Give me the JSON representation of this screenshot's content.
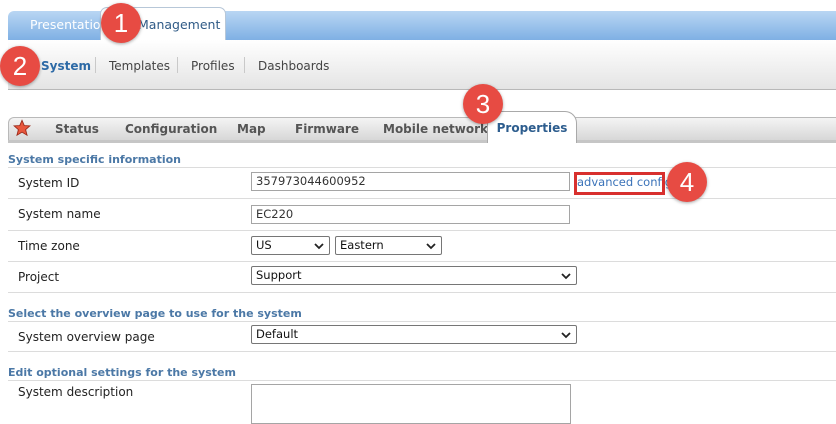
{
  "top_tabs": [
    "Presentation",
    "Management"
  ],
  "sub_nav": [
    "System",
    "Templates",
    "Profiles",
    "Dashboards"
  ],
  "tabs": [
    "Status",
    "Configuration",
    "Map",
    "Firmware",
    "Mobile network",
    "Properties"
  ],
  "sections": {
    "system_info": "System specific information",
    "overview": "Select the overview page to use for the system",
    "optional": "Edit optional settings for the system"
  },
  "fields": {
    "system_id_label": "System ID",
    "system_id_value": "357973044600952",
    "advanced_config": "advanced config",
    "system_name_label": "System name",
    "system_name_value": "EC220",
    "time_zone_label": "Time zone",
    "tz_country": "US",
    "tz_region": "Eastern",
    "project_label": "Project",
    "project_value": "Support",
    "overview_label": "System overview page",
    "overview_value": "Default",
    "description_label": "System description"
  },
  "badges": [
    "1",
    "2",
    "3",
    "4"
  ],
  "colors": {
    "accent": "#e74b43",
    "link": "#3b73b9",
    "header_blue": "#7fb0e4"
  }
}
